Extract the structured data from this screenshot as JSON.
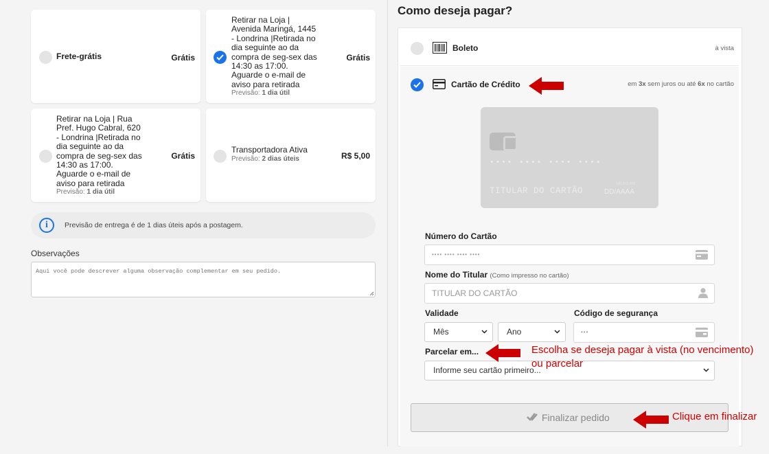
{
  "shipping": {
    "options": [
      {
        "name": "Frete-grátis",
        "price": "Grátis",
        "selected": false,
        "forecast_label": "",
        "forecast_value": ""
      },
      {
        "lines": [
          "Retirar na Loja |",
          "Avenida Maringá, 1445",
          "- Londrina |Retirada no",
          "dia seguinte ao da",
          "compra de seg-sex das",
          "14:30 as 17:00.",
          "Aguarde o e-mail de",
          "aviso para retirada"
        ],
        "price": "Grátis",
        "selected": true,
        "forecast_label": "Previsão:",
        "forecast_value": "1 dia útil"
      },
      {
        "lines": [
          "Retirar na Loja | Rua",
          "Pref. Hugo Cabral, 620",
          "- Londrina |Retirada no",
          "dia seguinte ao da",
          "compra de seg-sex das",
          "14:30 as 17:00.",
          "Aguarde o e-mail de",
          "aviso para retirada"
        ],
        "price": "Grátis",
        "selected": false,
        "forecast_label": "Previsão:",
        "forecast_value": "1 dia útil"
      },
      {
        "name": "Transportadora Ativa",
        "price": "R$ 5,00",
        "selected": false,
        "forecast_label": "Previsão:",
        "forecast_value": "2 dias úteis"
      }
    ],
    "info_text": "Previsão de entrega é de 1 dias úteis após a postagem."
  },
  "observations": {
    "label": "Observações",
    "placeholder": "Aqui você pode descrever alguma observação complementar em seu pedido."
  },
  "payment": {
    "title": "Como deseja pagar?",
    "methods": [
      {
        "name": "Boleto",
        "note": "à vista",
        "selected": false,
        "icon": "barcode-icon"
      },
      {
        "name": "Cartão de Crédito",
        "note_parts": [
          "em ",
          "3x",
          " sem juros ou até ",
          "6x",
          " no cartão"
        ],
        "selected": true,
        "icon": "credit-card-icon"
      }
    ],
    "card_preview": {
      "number": "•••• •••• •••• ••••",
      "holder": "TITULAR DO CARTÃO",
      "valid_label": "VÁLIDO ATÉ",
      "valid_value": "DD/AAAA"
    },
    "form": {
      "card_number_label": "Número do Cartão",
      "card_number_placeholder": "•••• •••• •••• ••••",
      "holder_label": "Nome do Titular",
      "holder_hint": "(Como impresso no cartão)",
      "holder_placeholder": "TITULAR DO CARTÃO",
      "validity_label": "Validade",
      "month_value": "Mês",
      "year_value": "Ano",
      "cvv_label": "Código de segurança",
      "cvv_placeholder": "•••",
      "installments_label": "Parcelar em...",
      "installments_value": "Informe seu cartão primeiro..."
    },
    "submit_label": "Finalizar pedido"
  },
  "annotations": {
    "installments_note_line1": "Escolha se deseja pagar à vista (no vencimento)",
    "installments_note_line2": "ou parcelar",
    "finalize_note": "Clique em finalizar",
    "arrow_color": "#cc0000"
  }
}
